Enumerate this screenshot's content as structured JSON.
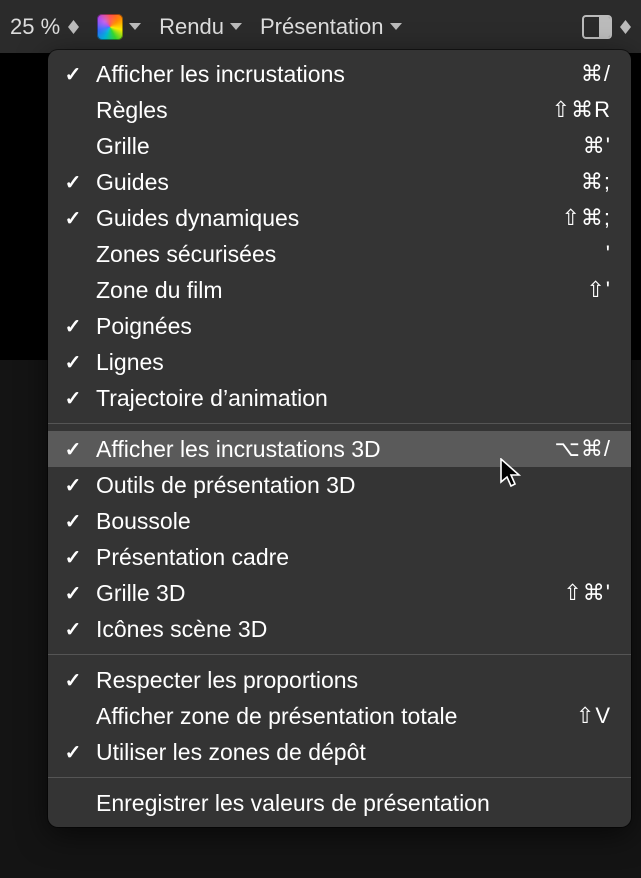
{
  "toolbar": {
    "zoom": "25 %",
    "rendu": "Rendu",
    "presentation": "Présentation"
  },
  "menu": {
    "group1": [
      {
        "label": "Afficher les incrustations",
        "checked": true,
        "shortcut": "⌘/"
      },
      {
        "label": "Règles",
        "checked": false,
        "shortcut": "⇧⌘R"
      },
      {
        "label": "Grille",
        "checked": false,
        "shortcut": "⌘'"
      },
      {
        "label": "Guides",
        "checked": true,
        "shortcut": "⌘;"
      },
      {
        "label": "Guides dynamiques",
        "checked": true,
        "shortcut": "⇧⌘;"
      },
      {
        "label": "Zones sécurisées",
        "checked": false,
        "shortcut": "'"
      },
      {
        "label": "Zone du film",
        "checked": false,
        "shortcut": "⇧'"
      },
      {
        "label": "Poignées",
        "checked": true,
        "shortcut": ""
      },
      {
        "label": "Lignes",
        "checked": true,
        "shortcut": ""
      },
      {
        "label": "Trajectoire d’animation",
        "checked": true,
        "shortcut": ""
      }
    ],
    "group2": [
      {
        "label": "Afficher les incrustations 3D",
        "checked": true,
        "shortcut": "⌥⌘/",
        "highlight": true
      },
      {
        "label": "Outils de présentation 3D",
        "checked": true,
        "shortcut": ""
      },
      {
        "label": "Boussole",
        "checked": true,
        "shortcut": ""
      },
      {
        "label": "Présentation cadre",
        "checked": true,
        "shortcut": ""
      },
      {
        "label": "Grille 3D",
        "checked": true,
        "shortcut": "⇧⌘'"
      },
      {
        "label": "Icônes scène 3D",
        "checked": true,
        "shortcut": ""
      }
    ],
    "group3": [
      {
        "label": "Respecter les proportions",
        "checked": true,
        "shortcut": ""
      },
      {
        "label": "Afficher zone de présentation totale",
        "checked": false,
        "shortcut": "⇧V"
      },
      {
        "label": "Utiliser les zones de dépôt",
        "checked": true,
        "shortcut": ""
      }
    ],
    "action": "Enregistrer les valeurs de présentation"
  }
}
